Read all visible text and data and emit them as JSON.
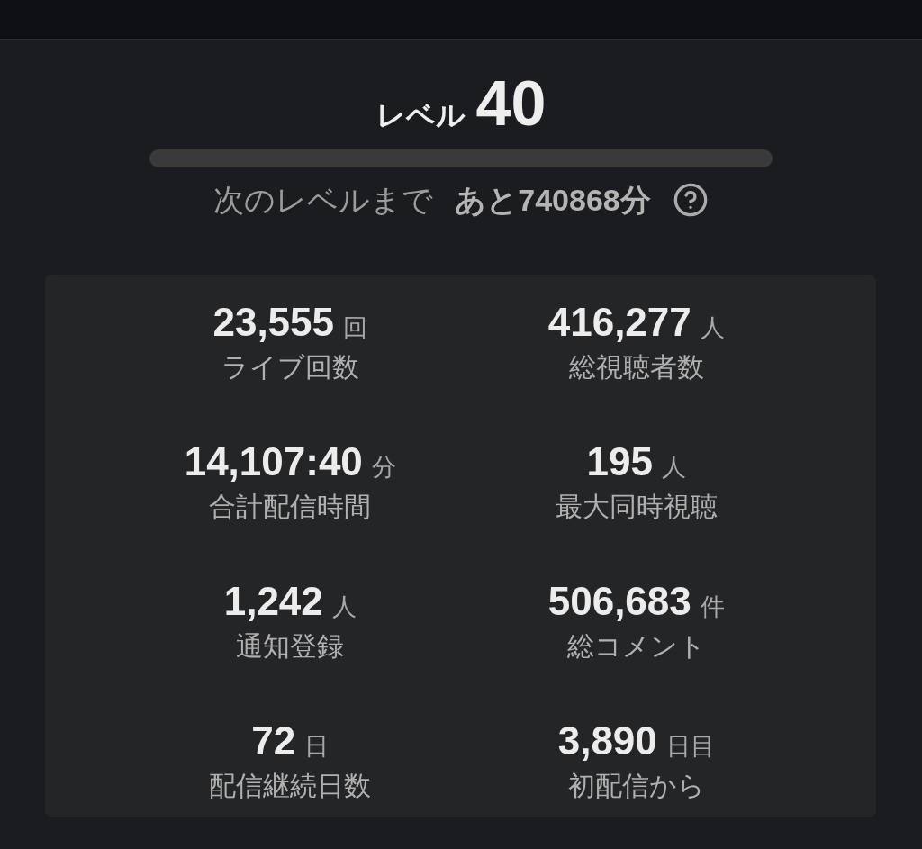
{
  "level_title": {
    "label": "レベル",
    "value": "40"
  },
  "progress": {
    "level": 0
  },
  "next_level": {
    "label": "次のレベルまで",
    "remaining": "あと740868分"
  },
  "stats": [
    {
      "value": "23,555",
      "unit": "回",
      "label": "ライブ回数"
    },
    {
      "value": "416,277",
      "unit": "人",
      "label": "総視聴者数"
    },
    {
      "value": "14,107:40",
      "unit": "分",
      "label": "合計配信時間"
    },
    {
      "value": "195",
      "unit": "人",
      "label": "最大同時視聴"
    },
    {
      "value": "1,242",
      "unit": "人",
      "label": "通知登録"
    },
    {
      "value": "506,683",
      "unit": "件",
      "label": "総コメント"
    },
    {
      "value": "72",
      "unit": "日",
      "label": "配信継続日数"
    },
    {
      "value": "3,890",
      "unit": "日目",
      "label": "初配信から"
    }
  ]
}
